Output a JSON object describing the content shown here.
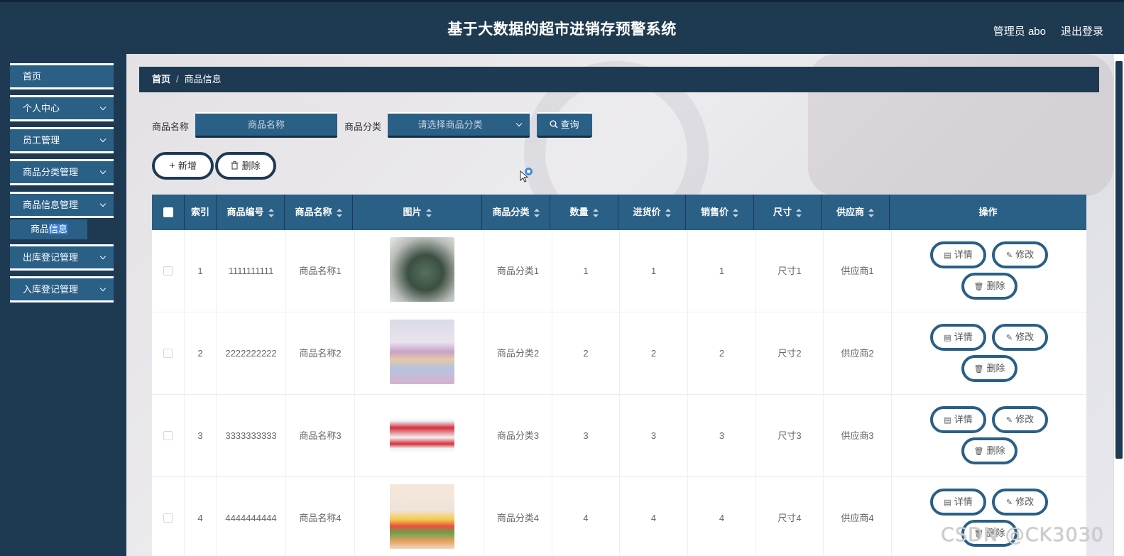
{
  "header": {
    "title": "基于大数据的超市进销存预警系统",
    "user": "管理员 abo",
    "logout": "退出登录"
  },
  "sidebar": {
    "items": [
      {
        "label": "首页",
        "has_arrow": false
      },
      {
        "label": "个人中心",
        "has_arrow": true
      },
      {
        "label": "员工管理",
        "has_arrow": true
      },
      {
        "label": "商品分类管理",
        "has_arrow": true
      },
      {
        "label": "商品信息管理",
        "has_arrow": true
      },
      {
        "label": "出库登记管理",
        "has_arrow": true
      },
      {
        "label": "入库登记管理",
        "has_arrow": true
      }
    ],
    "submenu": {
      "label_a": "商品",
      "label_b": "信息"
    }
  },
  "breadcrumb": {
    "home": "首页",
    "sep": "/",
    "current": "商品信息"
  },
  "search": {
    "name_label": "商品名称",
    "name_placeholder": "商品名称",
    "category_label": "商品分类",
    "category_placeholder": "请选择商品分类",
    "query_label": "查询"
  },
  "actions": {
    "add_label": "新增",
    "delete_label": "删除"
  },
  "table": {
    "headers": [
      "索引",
      "商品编号",
      "商品名称",
      "图片",
      "商品分类",
      "数量",
      "进货价",
      "销售价",
      "尺寸",
      "供应商",
      "操作"
    ],
    "rows": [
      {
        "index": "1",
        "code": "1111111111",
        "name": "商品名称1",
        "image": "shoe-photo",
        "category": "商品分类1",
        "qty": "1",
        "cost": "1",
        "price": "1",
        "size": "尺寸1",
        "supplier": "供应商1"
      },
      {
        "index": "2",
        "code": "2222222222",
        "name": "商品名称2",
        "image": "bedding-photo",
        "category": "商品分类2",
        "qty": "2",
        "cost": "2",
        "price": "2",
        "size": "尺寸2",
        "supplier": "供应商2"
      },
      {
        "index": "3",
        "code": "3333333333",
        "name": "商品名称3",
        "image": "toothpaste-photo",
        "category": "商品分类3",
        "qty": "3",
        "cost": "3",
        "price": "3",
        "size": "尺寸3",
        "supplier": "供应商3"
      },
      {
        "index": "4",
        "code": "4444444444",
        "name": "商品名称4",
        "image": "toothbrush-photo",
        "category": "商品分类4",
        "qty": "4",
        "cost": "4",
        "price": "4",
        "size": "尺寸4",
        "supplier": "供应商4"
      }
    ],
    "row_actions": {
      "detail": "详情",
      "edit": "修改",
      "delete": "删除"
    }
  },
  "watermark": "CSDN @CK3030",
  "colors": {
    "nav_dark": "#1e3a52",
    "nav_item": "#2a5f86",
    "accent": "#3b7fd8"
  }
}
